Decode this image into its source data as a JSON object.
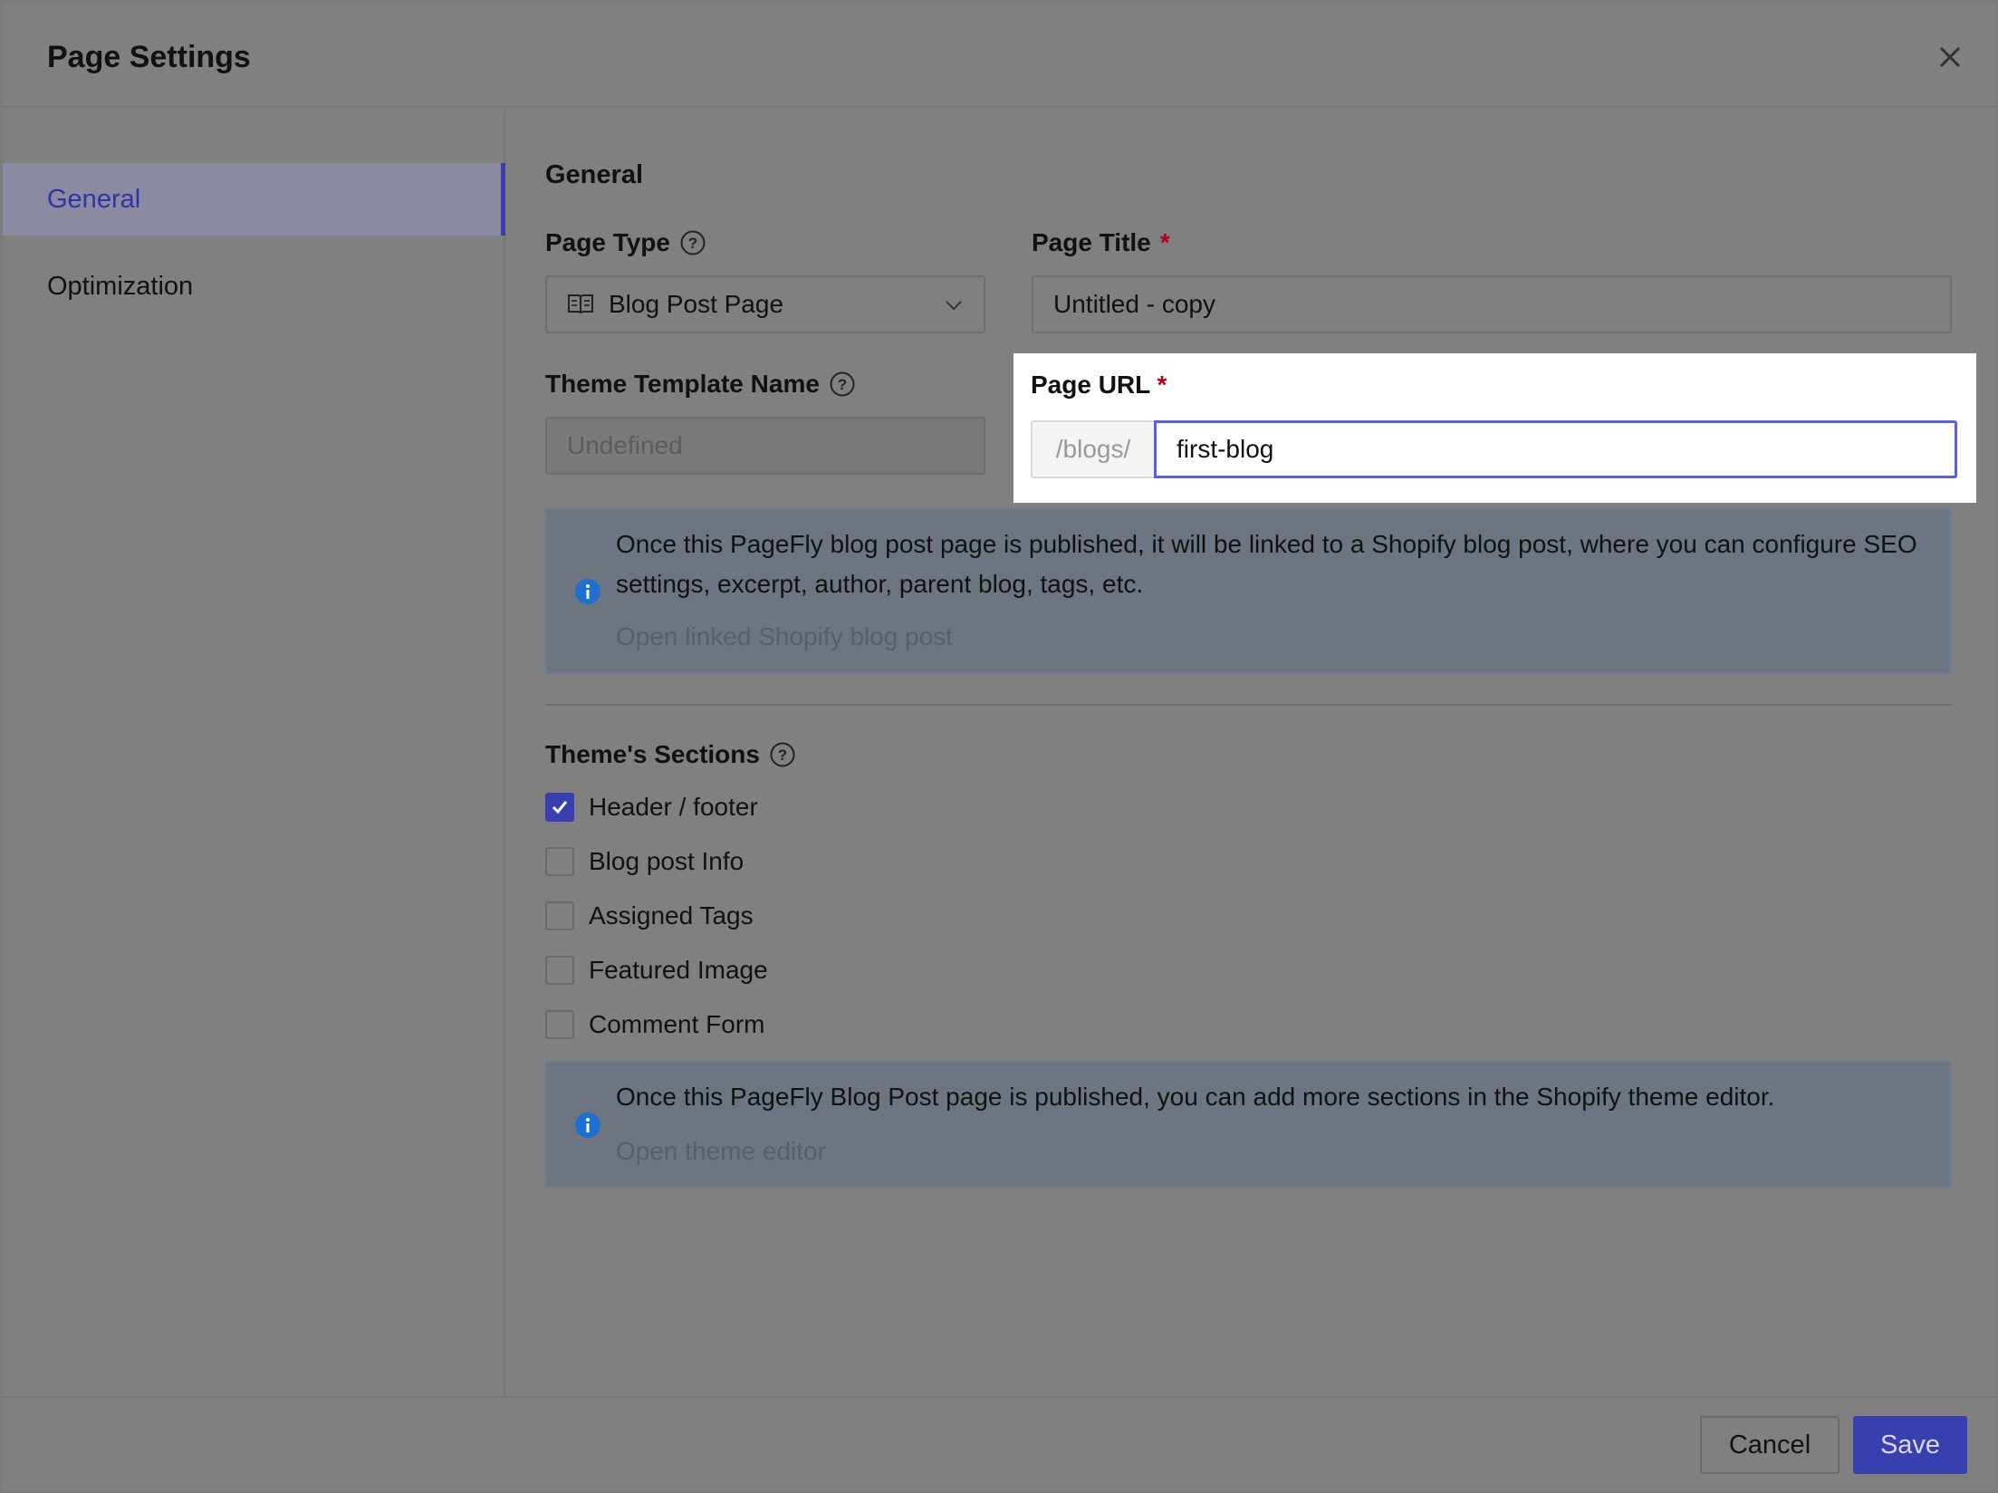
{
  "modal": {
    "title": "Page Settings"
  },
  "sidebar": {
    "items": [
      {
        "label": "General",
        "active": true
      },
      {
        "label": "Optimization",
        "active": false
      }
    ]
  },
  "general": {
    "section_title": "General",
    "page_type": {
      "label": "Page Type",
      "value": "Blog Post Page"
    },
    "page_title": {
      "label": "Page Title",
      "required_mark": "*",
      "value": "Untitled - copy"
    },
    "theme_template": {
      "label": "Theme Template Name",
      "placeholder": "Undefined"
    },
    "page_url": {
      "label": "Page URL",
      "required_mark": "*",
      "prefix": "/blogs/",
      "value": "first-blog"
    },
    "info": {
      "text": "Once this PageFly blog post page is published, it will be linked to a Shopify blog post, where you can configure SEO settings, excerpt, author, parent blog, tags, etc.",
      "link": "Open linked Shopify blog post"
    }
  },
  "sections": {
    "title": "Theme's Sections",
    "items": [
      {
        "label": "Header / footer",
        "checked": true
      },
      {
        "label": "Blog post Info",
        "checked": false
      },
      {
        "label": "Assigned Tags",
        "checked": false
      },
      {
        "label": "Featured Image",
        "checked": false
      },
      {
        "label": "Comment Form",
        "checked": false
      }
    ],
    "info": {
      "text": "Once this PageFly Blog Post page is published, you can add more sections in the Shopify theme editor.",
      "link": "Open theme editor"
    }
  },
  "footer": {
    "cancel_label": "Cancel",
    "save_label": "Save"
  },
  "colors": {
    "accent": "#3a3fb0",
    "required": "#b00020",
    "info_icon": "#1f6fd0"
  }
}
